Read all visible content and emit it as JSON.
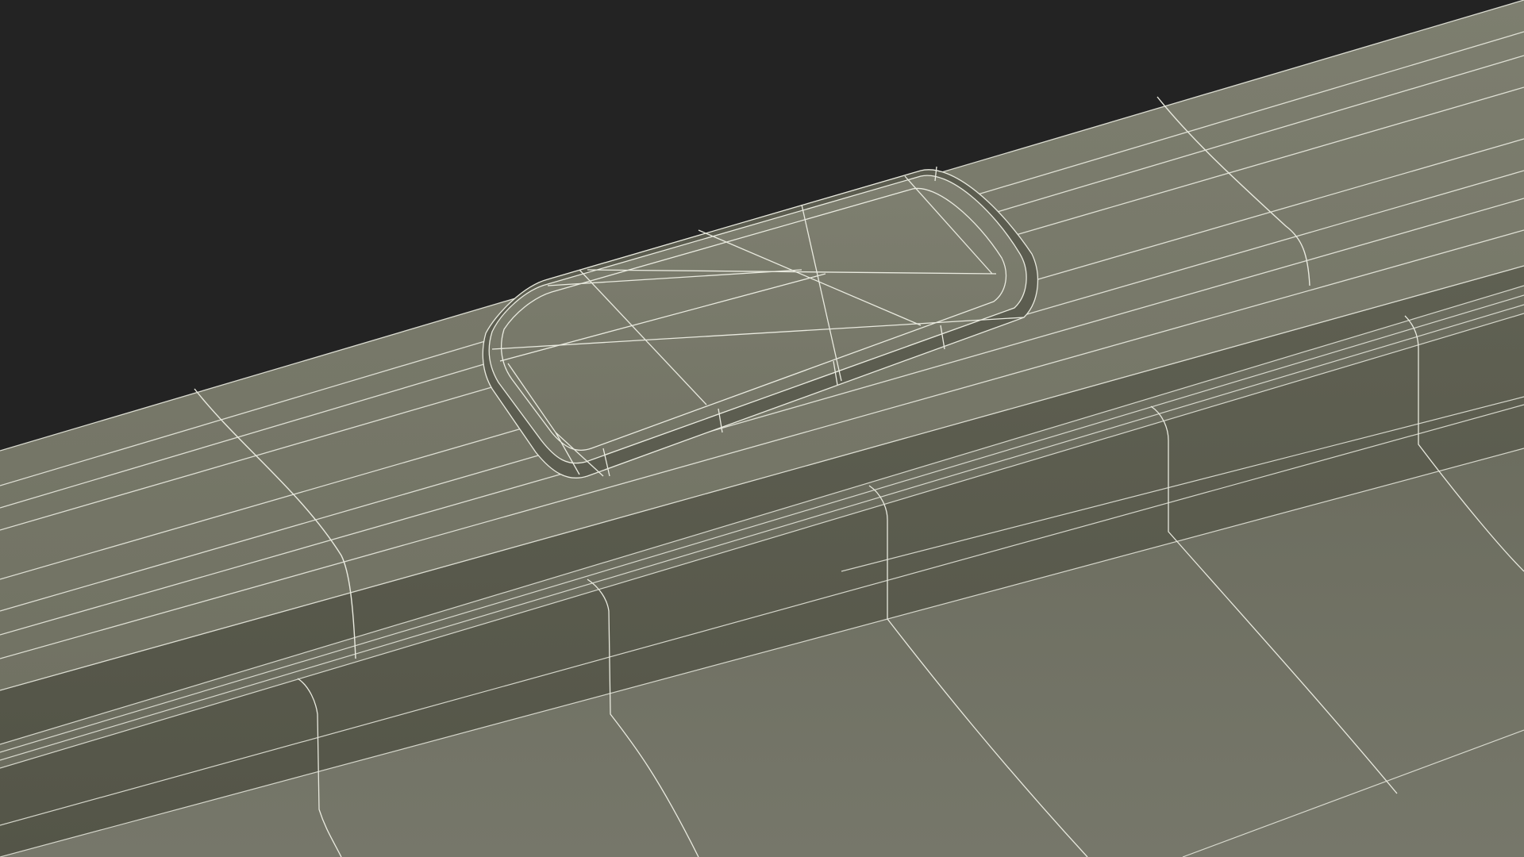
{
  "scene": {
    "kind": "3d-wireframe-render",
    "subject": "molded-rim-with-rounded-tab",
    "colors": {
      "background": "#232323",
      "surface_light": "#78796a",
      "surface_mid": "#6b6c5e",
      "surface_dark": "#595a4c",
      "surface_shadow": "#4f5044",
      "wire": "#e9eadf"
    }
  }
}
